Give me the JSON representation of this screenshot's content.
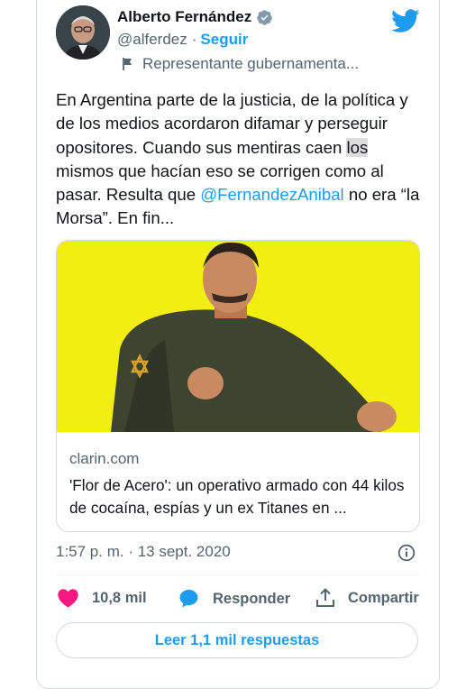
{
  "author": {
    "name": "Alberto Fernández",
    "handle": "@alferdez",
    "separator": "·",
    "follow_label": "Seguir",
    "label": "Representante gubernamenta..."
  },
  "tweet": {
    "text_1": "En Argentina parte de la justicia, de la política y de los medios acordaron difamar y perseguir opositores. Cuando sus mentiras caen ",
    "highlighted": "los",
    "text_2": " mismos que hacían eso se corrigen como al pasar. Resulta que ",
    "mention": "@FernandezAnibal",
    "text_3": " no era “la Morsa”. En fin..."
  },
  "link_card": {
    "domain": "clarin.com",
    "title": "'Flor de Acero': un operativo armado con 44 kilos de cocaína, espías y un ex Titanes en ..."
  },
  "timestamp": "1:57 p. m. · 13 sept. 2020",
  "actions": {
    "likes": "10,8 mil",
    "reply_label": "Responder",
    "share_label": "Compartir"
  },
  "read_replies_label": "Leer 1,1 mil respuestas",
  "colors": {
    "accent": "#1d9bf0",
    "like": "#f91880",
    "card_image_bg": "#f2ee12"
  }
}
